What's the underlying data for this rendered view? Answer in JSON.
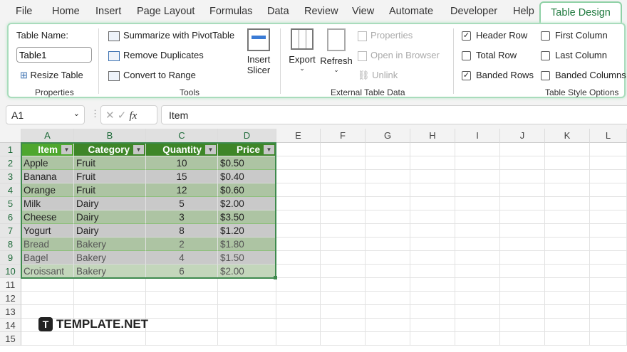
{
  "tabs": [
    "File",
    "Home",
    "Insert",
    "Page Layout",
    "Formulas",
    "Data",
    "Review",
    "View",
    "Automate",
    "Developer",
    "Help",
    "Table Design"
  ],
  "ribbon": {
    "table_name_label": "Table Name:",
    "table_name_value": "Table1",
    "resize_table": "Resize Table",
    "properties_group": "Properties",
    "summarize": "Summarize with PivotTable",
    "remove_duplicates": "Remove Duplicates",
    "convert_to_range": "Convert to Range",
    "insert_slicer_1": "Insert",
    "insert_slicer_2": "Slicer",
    "tools_group": "Tools",
    "export": "Export",
    "refresh": "Refresh",
    "properties": "Properties",
    "open_in_browser": "Open in Browser",
    "unlink": "Unlink",
    "external_group": "External Table Data",
    "header_row": "Header Row",
    "total_row": "Total Row",
    "banded_rows": "Banded Rows",
    "first_column": "First Column",
    "last_column": "Last Column",
    "banded_columns": "Banded Columns",
    "style_group": "Table Style Options"
  },
  "formula_bar": {
    "name_box": "A1",
    "fx": "fx",
    "content": "Item"
  },
  "columns": [
    "A",
    "B",
    "C",
    "D",
    "E",
    "F",
    "G",
    "H",
    "I",
    "J",
    "K",
    "L"
  ],
  "rows": [
    "1",
    "2",
    "3",
    "4",
    "5",
    "6",
    "7",
    "8",
    "9",
    "10",
    "11",
    "12",
    "13",
    "14",
    "15"
  ],
  "table": {
    "headers": [
      "Item",
      "Category",
      "Quantity",
      "Price"
    ],
    "data": [
      [
        "Apple",
        "Fruit",
        "10",
        "$0.50"
      ],
      [
        "Banana",
        "Fruit",
        "15",
        "$0.40"
      ],
      [
        "Orange",
        "Fruit",
        "12",
        "$0.60"
      ],
      [
        "Milk",
        "Dairy",
        "5",
        "$2.00"
      ],
      [
        "Cheese",
        "Dairy",
        "3",
        "$3.50"
      ],
      [
        "Yogurt",
        "Dairy",
        "8",
        "$1.20"
      ],
      [
        "Bread",
        "Bakery",
        "2",
        "$1.80"
      ],
      [
        "Bagel",
        "Bakery",
        "4",
        "$1.50"
      ],
      [
        "Croissant",
        "Bakery",
        "6",
        "$2.00"
      ]
    ]
  },
  "watermark": "TEMPLATE.NET"
}
